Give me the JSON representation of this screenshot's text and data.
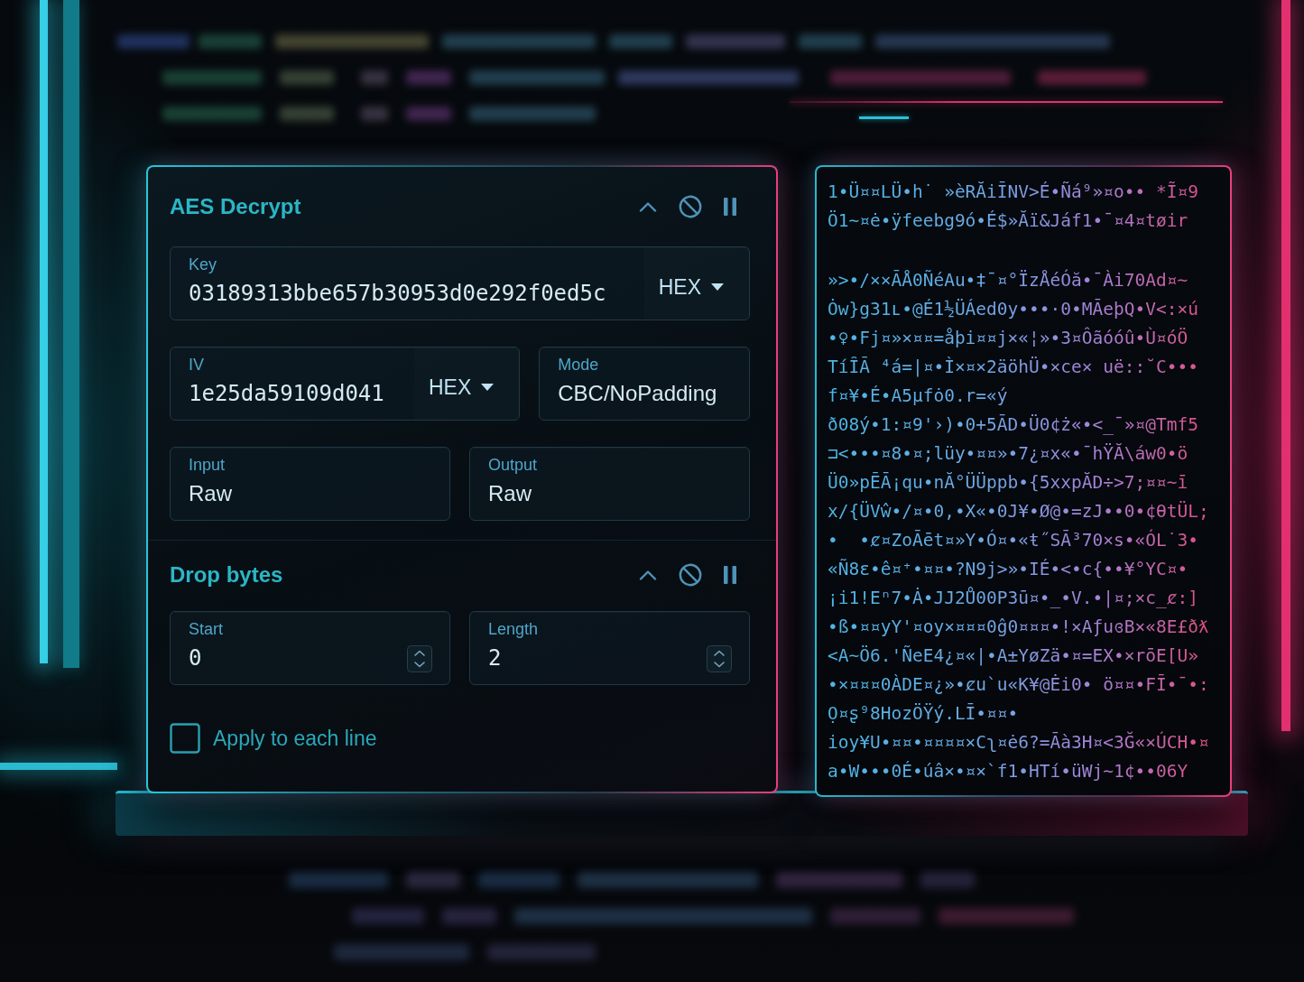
{
  "operations": [
    {
      "title": "AES Decrypt",
      "rows": [
        [
          {
            "kind": "format_input",
            "label": "Key",
            "value": "03189313bbe657b30953d0e292f0ed5c",
            "format": "HEX"
          }
        ],
        [
          {
            "kind": "format_input",
            "label": "IV",
            "value": "1e25da59109d041",
            "format": "HEX"
          },
          {
            "kind": "option",
            "label": "Mode",
            "value": "CBC/NoPadding"
          }
        ],
        [
          {
            "kind": "option",
            "label": "Input",
            "value": "Raw"
          },
          {
            "kind": "option",
            "label": "Output",
            "value": "Raw"
          }
        ]
      ]
    },
    {
      "title": "Drop bytes",
      "rows": [
        [
          {
            "kind": "number",
            "label": "Start",
            "value": "0"
          },
          {
            "kind": "number",
            "label": "Length",
            "value": "2"
          }
        ],
        [
          {
            "kind": "checkbox",
            "label": "Apply to each line",
            "checked": false
          }
        ]
      ]
    }
  ],
  "output": {
    "blocks": [
      {
        "lines": [
          "1•Ü¤¤LÜ•h˙ »èRĂiĪNV>É•Ñá⁹»¤o•• *Ĩ¤9",
          "Ö1~¤ė•ÿfeebg9ó•É$»Ăï&Jáf1•¯¤4¤tøir"
        ]
      },
      {
        "lines": [
          "»>•/××ĀÅ0ÑéAu•‡¯¤°ÏzÅéÓă•¯Ài70Ad¤~",
          "Ȯw}g31ʟ•@É1½ÜÁed0y•••·0•MĀeþQ•V<:×ú",
          "•♀•Fj¤»×¤¤=åþi¤¤j×«¦»•3¤Ôãóóû•Ù¤óÖ",
          "TíȊĀ ⁴á=|¤•Ì×¤×2äöhÜ•×ce× uë::˘C•••",
          "f¤¥•É•A5µfȯ0.r=«ý",
          "ð08ý•1:¤9'›)•0+5ĀD•Ü0¢ż«•<_¯»¤@Tmf5",
          "⊐<•••¤8•¤;lüy•¤¤»•7¿¤x«•¯hŸĂ\\áw0•ö",
          "Ü0»pĒĀ¡qu•nĂ°ÜÜppb•{5xxpĂD÷>7;¤¤~ī",
          "x/{ÜVŵ•/¤•0,•X«•0J¥•Ø@•=zJ••0•¢ƟtÜL;",
          "•  •ȼ¤ZoĀēt¤»Y•Ó¤•«ŧ˝SĀ³70×s•«ÓL˙3•",
          "«Ñ8ɛ•ê¤⁺•¤¤•?N9j>»•IÉ•<•c{••¥°YC¤•",
          "¡i1!Eⁿ7•Ȧ•JJ2Ů00P3ū¤•_•V.•|¤;×c_ȼ:]",
          "•ß•¤¤yY'¤oy×¤¤¤0ĝ0¤¤¤•!×AƒuɞB×«8E£ðƛ",
          "<A~Ö6.'ÑeE4¿¤«|•A±YøZä•¤=EX•×rōE[U»",
          "•×¤¤¤0ÀDE¤¿»•ȼu`u«K¥@Ėi0• ö¤¤•FĪ•¯•:",
          "Ọ¤ʂ⁹8HozÖŸý.LĪ•¤¤•",
          "ioy¥U•¤¤•¤¤¤¤×Cʅ¤ė6?=Āà3H¤<3Ğ«×ÚCH•¤",
          "a•W•••0É•úâ×•¤×`f1•HTí•üWj~1¢••06Y"
        ]
      }
    ]
  }
}
